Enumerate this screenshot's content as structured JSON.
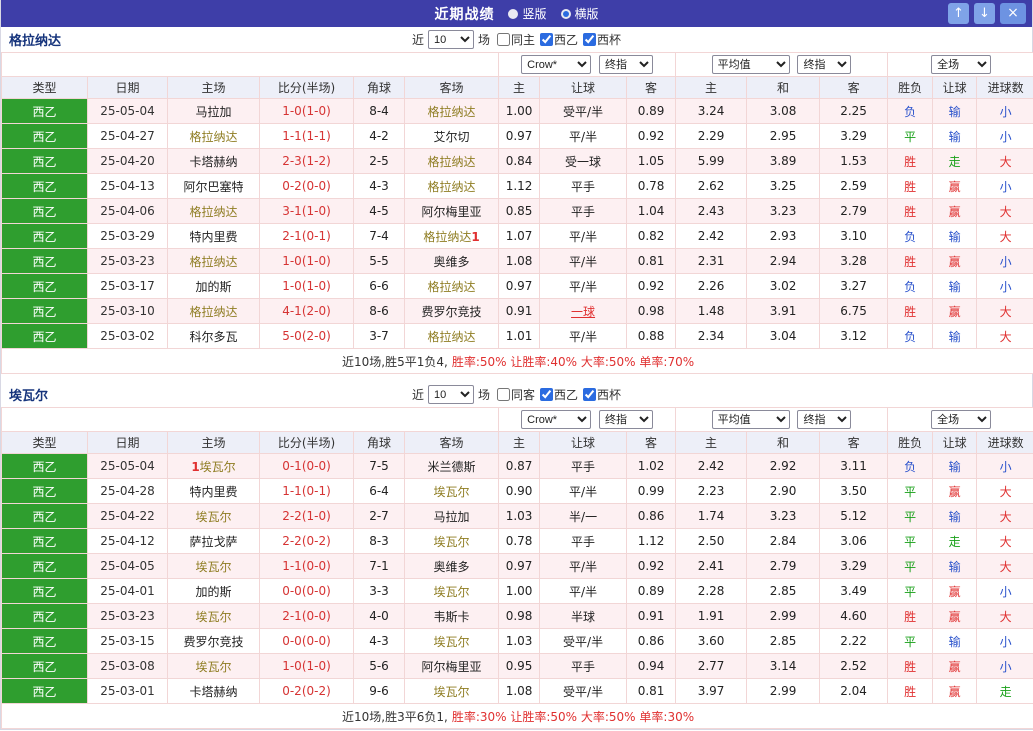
{
  "titlebar": {
    "title": "近期战绩",
    "radios": [
      {
        "label": "竖版",
        "selected": false
      },
      {
        "label": "横版",
        "selected": true
      }
    ],
    "icons": {
      "up": "↑",
      "down": "↓",
      "close": "×"
    },
    "bg_color": "#3e3ea8"
  },
  "columns": [
    "类型",
    "日期",
    "主场",
    "比分(半场)",
    "角球",
    "客场",
    "主",
    "让球",
    "客",
    "主",
    "和",
    "客",
    "胜负",
    "让球",
    "进球数"
  ],
  "status_colors": {
    "胜": "#e03030",
    "平": "#18a018",
    "负": "#2a52cc",
    "赢": "#e03030",
    "走": "#18a018",
    "输": "#2a52cc",
    "大": "#e03030",
    "小": "#2a52cc"
  },
  "accent": {
    "league_green": "#2f9e2f",
    "focus_team": "#8f7d22",
    "score_red": "#d63333"
  },
  "sections": [
    {
      "team": "格拉纳达",
      "filter": {
        "near_label": "近",
        "count": "10",
        "games_label": "场",
        "checkboxes": [
          {
            "label": "同主",
            "checked": false
          },
          {
            "label": "西乙",
            "checked": true
          },
          {
            "label": "西杯",
            "checked": true
          }
        ]
      },
      "dropdowns": {
        "bookmaker": "Crow*",
        "asian_time": "终指",
        "euro_source": "平均值",
        "euro_time": "终指",
        "scope": "全场"
      },
      "rows": [
        {
          "type": "西乙",
          "date": "25-05-04",
          "home": {
            "pre": "",
            "name": "马拉加",
            "focus": false,
            "post": ""
          },
          "score": "1-0(1-0)",
          "corner": "8-4",
          "away": {
            "pre": "",
            "name": "格拉纳达",
            "focus": true,
            "post": ""
          },
          "ah": [
            "1.00",
            "受平/半",
            "0.89"
          ],
          "ah_red": false,
          "eu": [
            "3.24",
            "3.08",
            "2.25"
          ],
          "res": "负",
          "ah_res": "输",
          "ou_res": "小"
        },
        {
          "type": "西乙",
          "date": "25-04-27",
          "home": {
            "pre": "",
            "name": "格拉纳达",
            "focus": true,
            "post": ""
          },
          "score": "1-1(1-1)",
          "corner": "4-2",
          "away": {
            "pre": "",
            "name": "艾尔切",
            "focus": false,
            "post": ""
          },
          "ah": [
            "0.97",
            "平/半",
            "0.92"
          ],
          "ah_red": false,
          "eu": [
            "2.29",
            "2.95",
            "3.29"
          ],
          "res": "平",
          "ah_res": "输",
          "ou_res": "小"
        },
        {
          "type": "西乙",
          "date": "25-04-20",
          "home": {
            "pre": "",
            "name": "卡塔赫纳",
            "focus": false,
            "post": ""
          },
          "score": "2-3(1-2)",
          "corner": "2-5",
          "away": {
            "pre": "",
            "name": "格拉纳达",
            "focus": true,
            "post": ""
          },
          "ah": [
            "0.84",
            "受一球",
            "1.05"
          ],
          "ah_red": false,
          "eu": [
            "5.99",
            "3.89",
            "1.53"
          ],
          "res": "胜",
          "ah_res": "走",
          "ou_res": "大"
        },
        {
          "type": "西乙",
          "date": "25-04-13",
          "home": {
            "pre": "",
            "name": "阿尔巴塞特",
            "focus": false,
            "post": ""
          },
          "score": "0-2(0-0)",
          "corner": "4-3",
          "away": {
            "pre": "",
            "name": "格拉纳达",
            "focus": true,
            "post": ""
          },
          "ah": [
            "1.12",
            "平手",
            "0.78"
          ],
          "ah_red": false,
          "eu": [
            "2.62",
            "3.25",
            "2.59"
          ],
          "res": "胜",
          "ah_res": "赢",
          "ou_res": "小"
        },
        {
          "type": "西乙",
          "date": "25-04-06",
          "home": {
            "pre": "",
            "name": "格拉纳达",
            "focus": true,
            "post": ""
          },
          "score": "3-1(1-0)",
          "corner": "4-5",
          "away": {
            "pre": "",
            "name": "阿尔梅里亚",
            "focus": false,
            "post": ""
          },
          "ah": [
            "0.85",
            "平手",
            "1.04"
          ],
          "ah_red": false,
          "eu": [
            "2.43",
            "3.23",
            "2.79"
          ],
          "res": "胜",
          "ah_res": "赢",
          "ou_res": "大"
        },
        {
          "type": "西乙",
          "date": "25-03-29",
          "home": {
            "pre": "",
            "name": "特内里费",
            "focus": false,
            "post": ""
          },
          "score": "2-1(0-1)",
          "corner": "7-4",
          "away": {
            "pre": "",
            "name": "格拉纳达",
            "focus": true,
            "post": "1"
          },
          "ah": [
            "1.07",
            "平/半",
            "0.82"
          ],
          "ah_red": false,
          "eu": [
            "2.42",
            "2.93",
            "3.10"
          ],
          "res": "负",
          "ah_res": "输",
          "ou_res": "大"
        },
        {
          "type": "西乙",
          "date": "25-03-23",
          "home": {
            "pre": "",
            "name": "格拉纳达",
            "focus": true,
            "post": ""
          },
          "score": "1-0(1-0)",
          "corner": "5-5",
          "away": {
            "pre": "",
            "name": "奥维多",
            "focus": false,
            "post": ""
          },
          "ah": [
            "1.08",
            "平/半",
            "0.81"
          ],
          "ah_red": false,
          "eu": [
            "2.31",
            "2.94",
            "3.28"
          ],
          "res": "胜",
          "ah_res": "赢",
          "ou_res": "小"
        },
        {
          "type": "西乙",
          "date": "25-03-17",
          "home": {
            "pre": "",
            "name": "加的斯",
            "focus": false,
            "post": ""
          },
          "score": "1-0(1-0)",
          "corner": "6-6",
          "away": {
            "pre": "",
            "name": "格拉纳达",
            "focus": true,
            "post": ""
          },
          "ah": [
            "0.97",
            "平/半",
            "0.92"
          ],
          "ah_red": false,
          "eu": [
            "2.26",
            "3.02",
            "3.27"
          ],
          "res": "负",
          "ah_res": "输",
          "ou_res": "小"
        },
        {
          "type": "西乙",
          "date": "25-03-10",
          "home": {
            "pre": "",
            "name": "格拉纳达",
            "focus": true,
            "post": ""
          },
          "score": "4-1(2-0)",
          "corner": "8-6",
          "away": {
            "pre": "",
            "name": "费罗尔竞技",
            "focus": false,
            "post": ""
          },
          "ah": [
            "0.91",
            "一球",
            "0.98"
          ],
          "ah_red": true,
          "eu": [
            "1.48",
            "3.91",
            "6.75"
          ],
          "res": "胜",
          "ah_res": "赢",
          "ou_res": "大"
        },
        {
          "type": "西乙",
          "date": "25-03-02",
          "home": {
            "pre": "",
            "name": "科尔多瓦",
            "focus": false,
            "post": ""
          },
          "score": "5-0(2-0)",
          "corner": "3-7",
          "away": {
            "pre": "",
            "name": "格拉纳达",
            "focus": true,
            "post": ""
          },
          "ah": [
            "1.01",
            "平/半",
            "0.88"
          ],
          "ah_red": false,
          "eu": [
            "2.34",
            "3.04",
            "3.12"
          ],
          "res": "负",
          "ah_res": "输",
          "ou_res": "大"
        }
      ],
      "summary": {
        "record": "近10场,胜5平1负4,",
        "rates": "胜率:50% 让胜率:40% 大率:50% 单率:70%"
      }
    },
    {
      "team": "埃瓦尔",
      "filter": {
        "near_label": "近",
        "count": "10",
        "games_label": "场",
        "checkboxes": [
          {
            "label": "同客",
            "checked": false
          },
          {
            "label": "西乙",
            "checked": true
          },
          {
            "label": "西杯",
            "checked": true
          }
        ]
      },
      "dropdowns": {
        "bookmaker": "Crow*",
        "asian_time": "终指",
        "euro_source": "平均值",
        "euro_time": "终指",
        "scope": "全场"
      },
      "rows": [
        {
          "type": "西乙",
          "date": "25-05-04",
          "home": {
            "pre": "1",
            "name": "埃瓦尔",
            "focus": true,
            "post": ""
          },
          "score": "0-1(0-0)",
          "corner": "7-5",
          "away": {
            "pre": "",
            "name": "米兰德斯",
            "focus": false,
            "post": ""
          },
          "ah": [
            "0.87",
            "平手",
            "1.02"
          ],
          "ah_red": false,
          "eu": [
            "2.42",
            "2.92",
            "3.11"
          ],
          "res": "负",
          "ah_res": "输",
          "ou_res": "小"
        },
        {
          "type": "西乙",
          "date": "25-04-28",
          "home": {
            "pre": "",
            "name": "特内里费",
            "focus": false,
            "post": ""
          },
          "score": "1-1(0-1)",
          "corner": "6-4",
          "away": {
            "pre": "",
            "name": "埃瓦尔",
            "focus": true,
            "post": ""
          },
          "ah": [
            "0.90",
            "平/半",
            "0.99"
          ],
          "ah_red": false,
          "eu": [
            "2.23",
            "2.90",
            "3.50"
          ],
          "res": "平",
          "ah_res": "赢",
          "ou_res": "大"
        },
        {
          "type": "西乙",
          "date": "25-04-22",
          "home": {
            "pre": "",
            "name": "埃瓦尔",
            "focus": true,
            "post": ""
          },
          "score": "2-2(1-0)",
          "corner": "2-7",
          "away": {
            "pre": "",
            "name": "马拉加",
            "focus": false,
            "post": ""
          },
          "ah": [
            "1.03",
            "半/一",
            "0.86"
          ],
          "ah_red": false,
          "eu": [
            "1.74",
            "3.23",
            "5.12"
          ],
          "res": "平",
          "ah_res": "输",
          "ou_res": "大"
        },
        {
          "type": "西乙",
          "date": "25-04-12",
          "home": {
            "pre": "",
            "name": "萨拉戈萨",
            "focus": false,
            "post": ""
          },
          "score": "2-2(0-2)",
          "corner": "8-3",
          "away": {
            "pre": "",
            "name": "埃瓦尔",
            "focus": true,
            "post": ""
          },
          "ah": [
            "0.78",
            "平手",
            "1.12"
          ],
          "ah_red": false,
          "eu": [
            "2.50",
            "2.84",
            "3.06"
          ],
          "res": "平",
          "ah_res": "走",
          "ou_res": "大"
        },
        {
          "type": "西乙",
          "date": "25-04-05",
          "home": {
            "pre": "",
            "name": "埃瓦尔",
            "focus": true,
            "post": ""
          },
          "score": "1-1(0-0)",
          "corner": "7-1",
          "away": {
            "pre": "",
            "name": "奥维多",
            "focus": false,
            "post": ""
          },
          "ah": [
            "0.97",
            "平/半",
            "0.92"
          ],
          "ah_red": false,
          "eu": [
            "2.41",
            "2.79",
            "3.29"
          ],
          "res": "平",
          "ah_res": "输",
          "ou_res": "大"
        },
        {
          "type": "西乙",
          "date": "25-04-01",
          "home": {
            "pre": "",
            "name": "加的斯",
            "focus": false,
            "post": ""
          },
          "score": "0-0(0-0)",
          "corner": "3-3",
          "away": {
            "pre": "",
            "name": "埃瓦尔",
            "focus": true,
            "post": ""
          },
          "ah": [
            "1.00",
            "平/半",
            "0.89"
          ],
          "ah_red": false,
          "eu": [
            "2.28",
            "2.85",
            "3.49"
          ],
          "res": "平",
          "ah_res": "赢",
          "ou_res": "小"
        },
        {
          "type": "西乙",
          "date": "25-03-23",
          "home": {
            "pre": "",
            "name": "埃瓦尔",
            "focus": true,
            "post": ""
          },
          "score": "2-1(0-0)",
          "corner": "4-0",
          "away": {
            "pre": "",
            "name": "韦斯卡",
            "focus": false,
            "post": ""
          },
          "ah": [
            "0.98",
            "半球",
            "0.91"
          ],
          "ah_red": false,
          "eu": [
            "1.91",
            "2.99",
            "4.60"
          ],
          "res": "胜",
          "ah_res": "赢",
          "ou_res": "大"
        },
        {
          "type": "西乙",
          "date": "25-03-15",
          "home": {
            "pre": "",
            "name": "费罗尔竞技",
            "focus": false,
            "post": ""
          },
          "score": "0-0(0-0)",
          "corner": "4-3",
          "away": {
            "pre": "",
            "name": "埃瓦尔",
            "focus": true,
            "post": ""
          },
          "ah": [
            "1.03",
            "受平/半",
            "0.86"
          ],
          "ah_red": false,
          "eu": [
            "3.60",
            "2.85",
            "2.22"
          ],
          "res": "平",
          "ah_res": "输",
          "ou_res": "小"
        },
        {
          "type": "西乙",
          "date": "25-03-08",
          "home": {
            "pre": "",
            "name": "埃瓦尔",
            "focus": true,
            "post": ""
          },
          "score": "1-0(1-0)",
          "corner": "5-6",
          "away": {
            "pre": "",
            "name": "阿尔梅里亚",
            "focus": false,
            "post": ""
          },
          "ah": [
            "0.95",
            "平手",
            "0.94"
          ],
          "ah_red": false,
          "eu": [
            "2.77",
            "3.14",
            "2.52"
          ],
          "res": "胜",
          "ah_res": "赢",
          "ou_res": "小"
        },
        {
          "type": "西乙",
          "date": "25-03-01",
          "home": {
            "pre": "",
            "name": "卡塔赫纳",
            "focus": false,
            "post": ""
          },
          "score": "0-2(0-2)",
          "corner": "9-6",
          "away": {
            "pre": "",
            "name": "埃瓦尔",
            "focus": true,
            "post": ""
          },
          "ah": [
            "1.08",
            "受平/半",
            "0.81"
          ],
          "ah_red": false,
          "eu": [
            "3.97",
            "2.99",
            "2.04"
          ],
          "res": "胜",
          "ah_res": "赢",
          "ou_res": "走"
        }
      ],
      "summary": {
        "record": "近10场,胜3平6负1,",
        "rates": "胜率:30% 让胜率:50% 大率:50% 单率:30%"
      }
    }
  ]
}
